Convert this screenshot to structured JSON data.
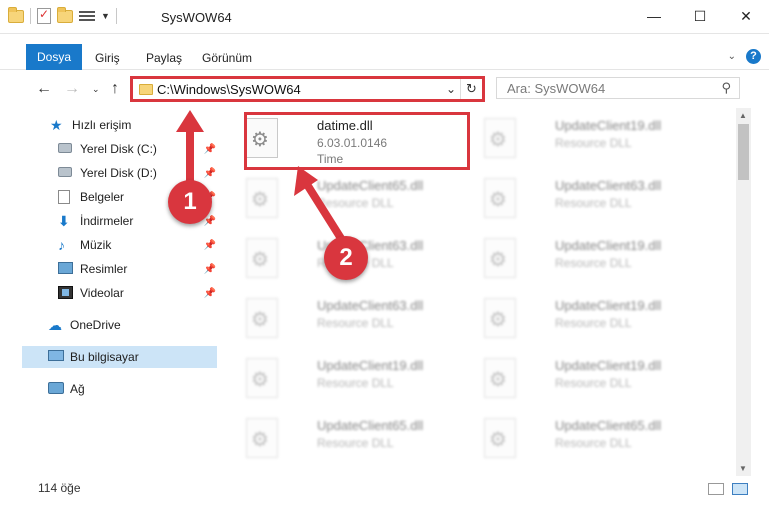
{
  "window": {
    "title": "SysWOW64",
    "minimize_glyph": "—",
    "maximize_glyph": "☐",
    "close_glyph": "✕"
  },
  "ribbon": {
    "tabs": [
      {
        "label": "Dosya",
        "active": true
      },
      {
        "label": "Giriş",
        "active": false
      },
      {
        "label": "Paylaş",
        "active": false
      },
      {
        "label": "Görünüm",
        "active": false
      }
    ],
    "help_label": "?"
  },
  "nav": {
    "address": "C:\\Windows\\SysWOW64",
    "search_placeholder": "Ara: SysWOW64"
  },
  "sidebar": {
    "items": [
      {
        "label": "Hızlı erişim",
        "icon": "star-icon"
      },
      {
        "label": "Yerel Disk (C:)",
        "icon": "disk-icon",
        "pinned": true
      },
      {
        "label": "Yerel Disk (D:)",
        "icon": "disk-icon",
        "pinned": true
      },
      {
        "label": "Belgeler",
        "icon": "document-icon",
        "pinned": true
      },
      {
        "label": "İndirmeler",
        "icon": "download-icon",
        "pinned": true
      },
      {
        "label": "Müzik",
        "icon": "music-icon",
        "pinned": true
      },
      {
        "label": "Resimler",
        "icon": "pictures-icon",
        "pinned": true
      },
      {
        "label": "Videolar",
        "icon": "videos-icon",
        "pinned": true
      },
      {
        "label": "OneDrive",
        "icon": "cloud-icon"
      },
      {
        "label": "Bu bilgisayar",
        "icon": "computer-icon",
        "selected": true
      },
      {
        "label": "Ağ",
        "icon": "network-icon"
      }
    ]
  },
  "files": {
    "highlighted": {
      "name": "datime.dll",
      "version": "6.03.01.0146",
      "description": "Time"
    },
    "others": [
      {
        "name": "UpdateClient19.dll",
        "type": "Resource DLL"
      },
      {
        "name": "UpdateClient65.dll",
        "type": "Resource DLL"
      },
      {
        "name": "UpdateClient63.dll",
        "type": "Resource DLL"
      },
      {
        "name": "UpdateClient63.dll",
        "type": "Resource DLL"
      },
      {
        "name": "UpdateClient19.dll",
        "type": "Resource DLL"
      },
      {
        "name": "UpdateClient63.dll",
        "type": "Resource DLL"
      },
      {
        "name": "UpdateClient19.dll",
        "type": "Resource DLL"
      },
      {
        "name": "UpdateClient19.dll",
        "type": "Resource DLL"
      },
      {
        "name": "UpdateClient19.dll",
        "type": "Resource DLL"
      },
      {
        "name": "UpdateClient65.dll",
        "type": "Resource DLL"
      },
      {
        "name": "UpdateClient65.dll",
        "type": "Resource DLL"
      }
    ]
  },
  "status": {
    "item_count": "114 öğe"
  },
  "annotations": {
    "step1": "1",
    "step2": "2",
    "color": "#d9363e"
  }
}
